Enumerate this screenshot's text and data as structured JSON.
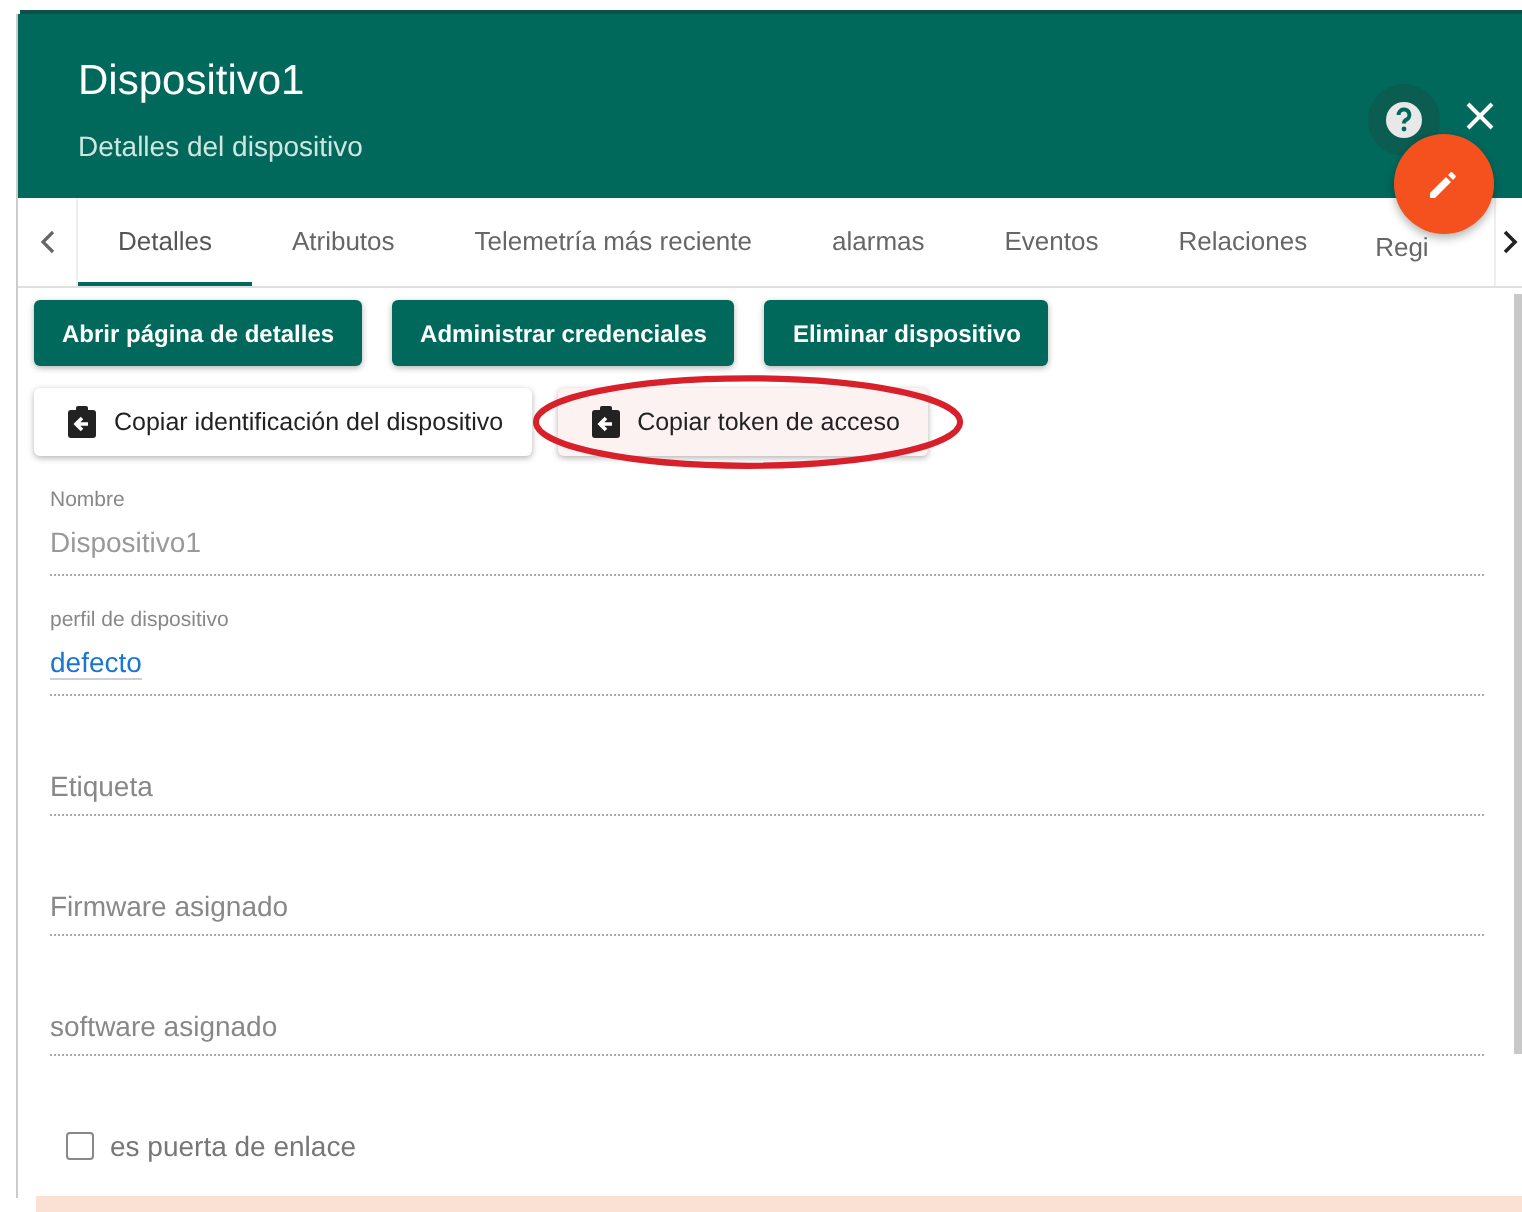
{
  "header": {
    "title": "Dispositivo1",
    "subtitle": "Detalles del dispositivo"
  },
  "tabs": [
    {
      "label": "Detalles",
      "selected": true
    },
    {
      "label": "Atributos",
      "selected": false
    },
    {
      "label": "Telemetría más reciente",
      "selected": false
    },
    {
      "label": "alarmas",
      "selected": false
    },
    {
      "label": "Eventos",
      "selected": false
    },
    {
      "label": "Relaciones",
      "selected": false
    },
    {
      "label": "Regi",
      "selected": false
    }
  ],
  "actions": [
    "Abrir página de detalles",
    "Administrar credenciales",
    "Eliminar dispositivo"
  ],
  "copy_buttons": [
    {
      "label": "Copiar identificación del dispositivo",
      "highlighted": false
    },
    {
      "label": "Copiar token de acceso",
      "highlighted": true
    }
  ],
  "fields": [
    {
      "label": "Nombre",
      "value": "Dispositivo1",
      "kind": "disabled"
    },
    {
      "label": "perfil de dispositivo",
      "value": "defecto",
      "kind": "link"
    },
    {
      "placeholder": "Etiqueta",
      "kind": "empty"
    },
    {
      "placeholder": "Firmware asignado",
      "kind": "empty"
    },
    {
      "placeholder": "software asignado",
      "kind": "empty"
    }
  ],
  "gateway": {
    "label": "es puerta de enlace",
    "checked": false
  }
}
